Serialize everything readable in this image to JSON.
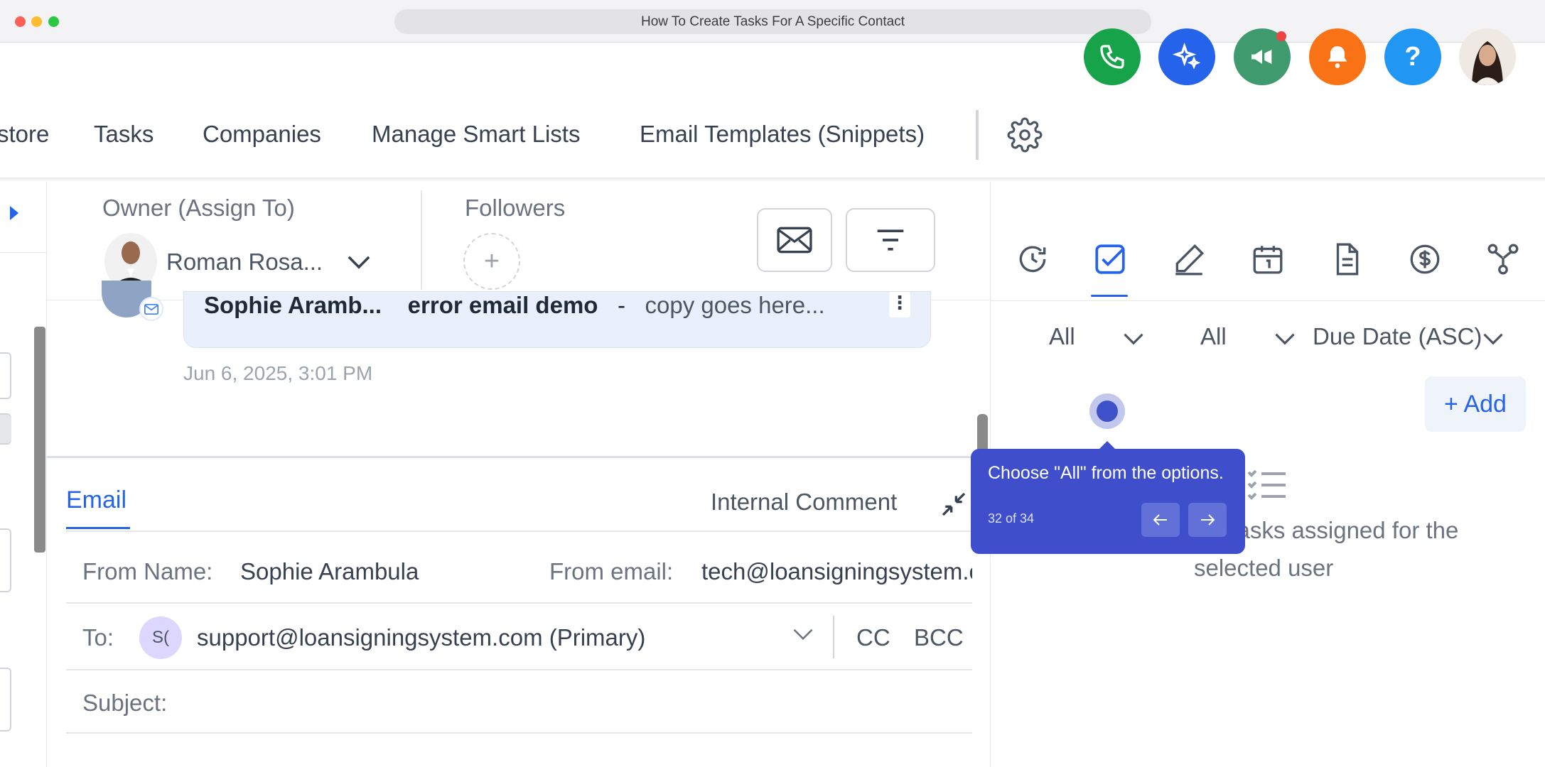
{
  "window": {
    "title": "How To Create Tasks For A Specific Contact"
  },
  "header": {
    "nav": [
      "store",
      "Tasks",
      "Companies",
      "Manage Smart Lists",
      "Email Templates (Snippets)"
    ],
    "help_label": "?"
  },
  "contact": {
    "owner_label": "Owner (Assign To)",
    "owner_name": "Roman Rosa...",
    "followers_label": "Followers",
    "add_follower": "+"
  },
  "conversation": {
    "sender": "Sophie Aramb...",
    "subject": "error email demo",
    "separator": "-",
    "preview": "copy goes here...",
    "menu": "⋮",
    "date": "Jun 6, 2025, 3:01 PM"
  },
  "composer": {
    "tab_email": "Email",
    "tab_internal": "Internal Comment",
    "from_name_label": "From Name:",
    "from_name_value": "Sophie Arambula",
    "from_email_label": "From email:",
    "from_email_value": "tech@loansigningsystem.com",
    "to_label": "To:",
    "to_initials": "S(",
    "to_value": "support@loansigningsystem.com (Primary)",
    "cc": "CC",
    "bcc": "BCC",
    "subject_label": "Subject:"
  },
  "tasks_panel": {
    "filter_1": "All",
    "filter_2": "All",
    "sort": "Due Date (ASC)",
    "add_button": "+ Add",
    "empty_message": "No tasks assigned for the selected user"
  },
  "tour": {
    "message": "Choose \"All\" from the options.",
    "step": "32 of 34"
  },
  "colors": {
    "accent": "#2563eb",
    "tour_bg": "#3f4fcc",
    "phone": "#16a34a",
    "bell": "#f97316",
    "help": "#2196f3"
  }
}
